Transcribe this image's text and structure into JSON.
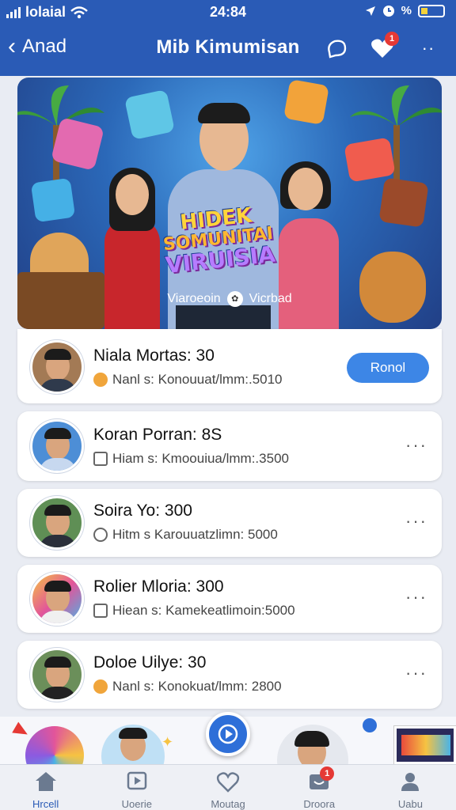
{
  "status_bar": {
    "carrier": "lolaial",
    "time": "24:84",
    "battery_text": "%"
  },
  "header": {
    "back_label": "Anad",
    "title": "Mib Kimumisan",
    "notification_count": "1"
  },
  "hero": {
    "logo_line1": "HIDEK",
    "logo_line2": "SOMUNITAI",
    "logo_line3": "VIRUISIA",
    "caption_left": "Viaroeoin",
    "caption_right": "Vicrbad"
  },
  "list": [
    {
      "name": "Niala Mortas: 30",
      "meta": "Nanl s: Konouuat/lmm:.5010",
      "action_label": "Ronol"
    },
    {
      "name": "Koran Porran: 8S",
      "meta": "Hiam s: Kmoouiua/lmm:.3500"
    },
    {
      "name": "Soira Yo: 300",
      "meta": "Hitm s Karouuatzlimn: 5000"
    },
    {
      "name": "Rolier Mloria: 300",
      "meta": "Hiean s: Kamekeatlimoin:5000"
    },
    {
      "name": "Doloe Uilye: 30",
      "meta": "Nanl s: Konokuat/lmm: 2800"
    }
  ],
  "tabbar": {
    "tabs": [
      {
        "label": "Hrcell",
        "icon": "home-icon"
      },
      {
        "label": "Uoerie",
        "icon": "play-icon"
      },
      {
        "label": "Moutag",
        "icon": "heart-icon"
      },
      {
        "label": "Droora",
        "icon": "inbox-icon",
        "badge": "1"
      },
      {
        "label": "Uabu",
        "icon": "profile-icon"
      }
    ]
  },
  "colors": {
    "header_blue": "#2a5bb6",
    "action_blue": "#3d86e6",
    "badge_red": "#e53935"
  }
}
